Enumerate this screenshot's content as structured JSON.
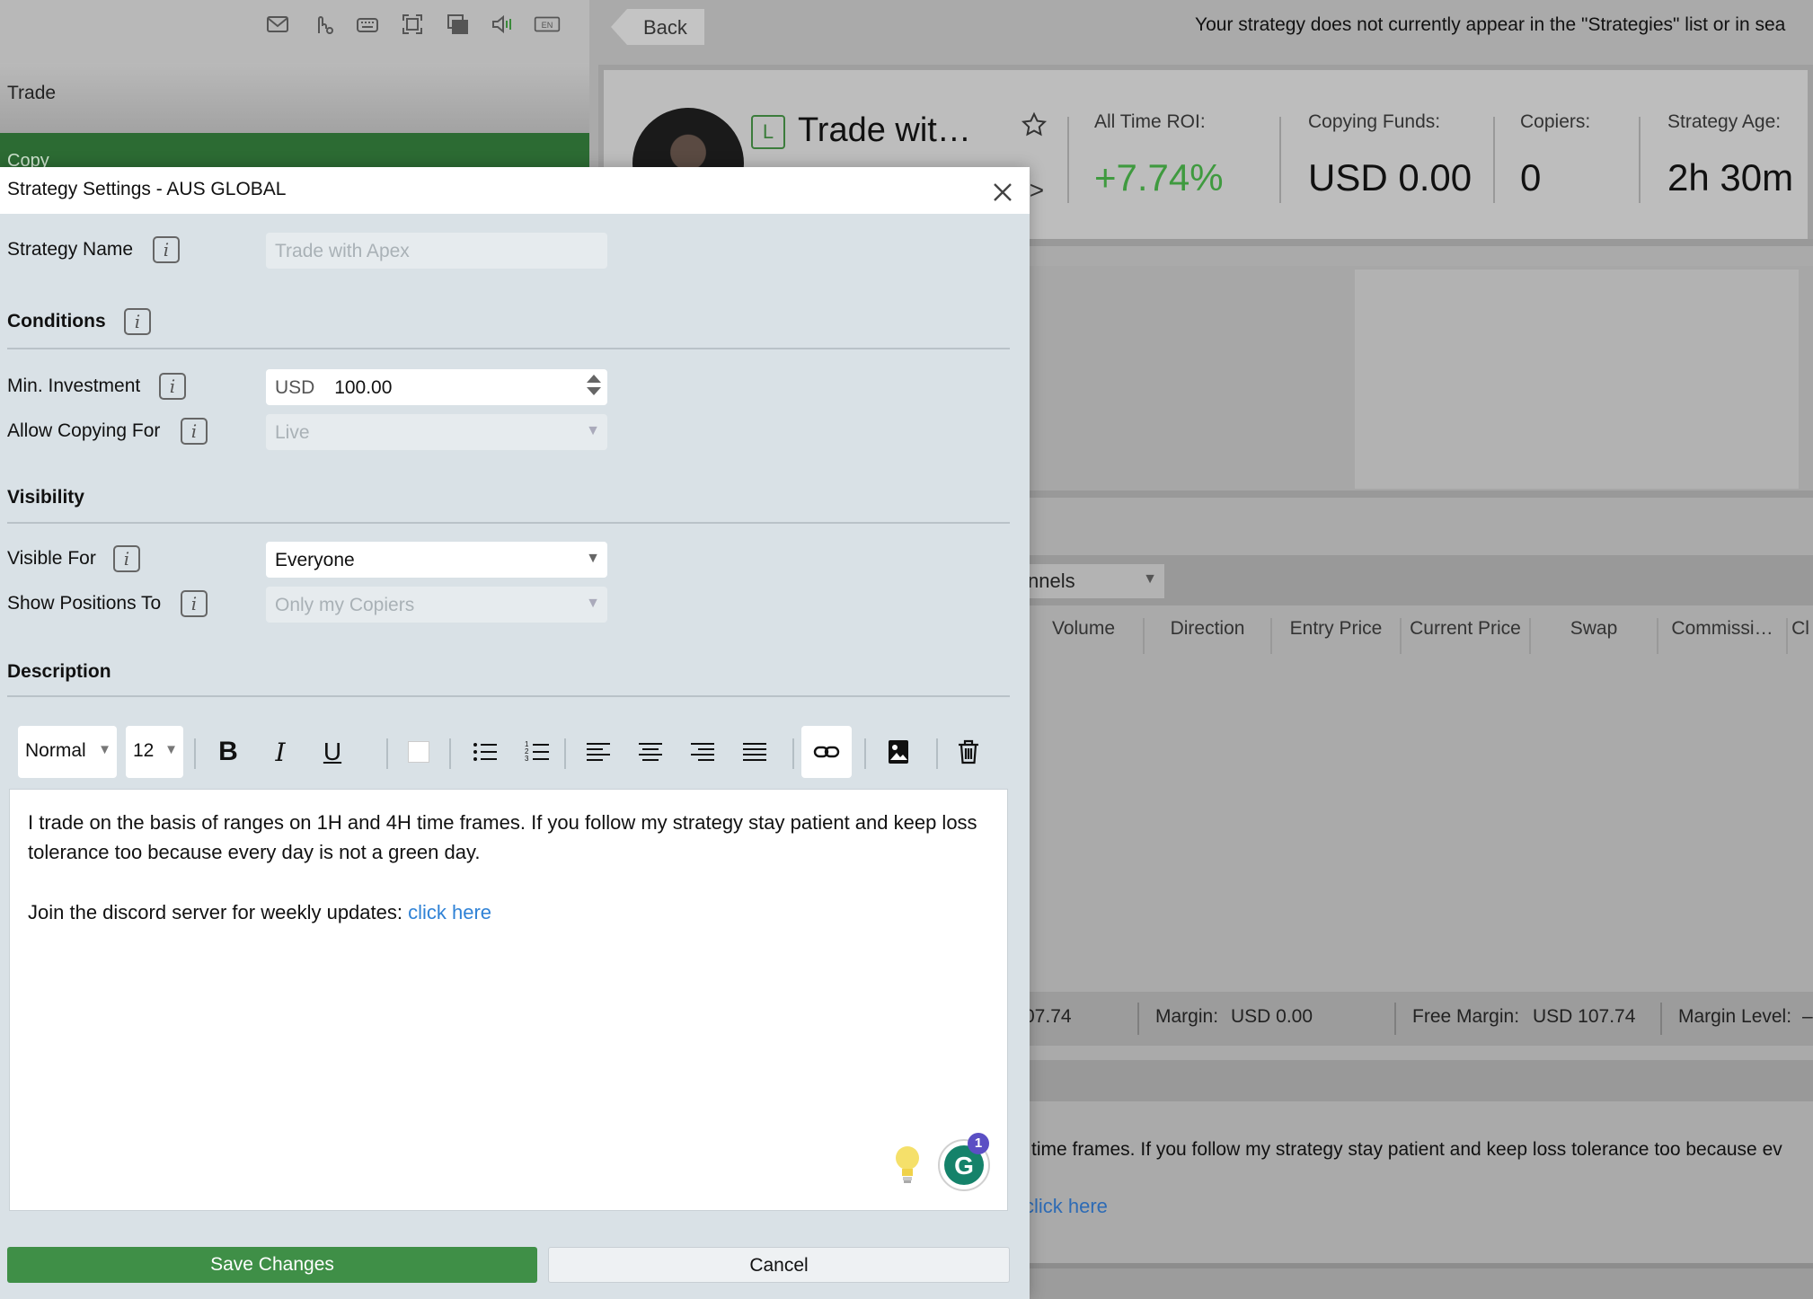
{
  "background": {
    "toolbar_icons": [
      "mail-icon",
      "touch-settings-icon",
      "keyboard-icon",
      "fullscreen-icon",
      "windows-icon",
      "volume-icon",
      "language-icon"
    ],
    "language_label": "EN",
    "left_trade_label": "Trade",
    "left_copy_label": "Copy",
    "back_label": "Back",
    "notice": "Your strategy does not currently appear in the \"Strategies\" list or in sea",
    "strategy_type_badge": "L",
    "strategy_title": "Trade wit…",
    "code_symbol": "/>",
    "stats": {
      "roi_label": "All Time ROI:",
      "roi_value": "+7.74%",
      "funds_label": "Copying Funds:",
      "funds_value": "USD 0.00",
      "copiers_label": "Copiers:",
      "copiers_value": "0",
      "age_label": "Strategy Age:",
      "age_value": "2h 30m"
    },
    "channels_value": "nnels",
    "columns": [
      "Volume",
      "Direction",
      "Entry Price",
      "Current Price",
      "Swap",
      "Commissi…",
      "Cl"
    ],
    "account": {
      "balance_partial": "07.74",
      "margin_label": "Margin:",
      "margin_value": "USD 0.00",
      "free_margin_label": "Free Margin:",
      "free_margin_value": "USD 107.74",
      "margin_level_label": "Margin Level:",
      "margin_level_value": "–"
    },
    "desc_text": "time frames. If you follow my strategy stay patient and keep loss tolerance too because ev",
    "desc_link": "click here"
  },
  "modal": {
    "title": "Strategy Settings - AUS GLOBAL",
    "strategy_name_label": "Strategy Name",
    "strategy_name_value": "Trade with Apex",
    "conditions_title": "Conditions",
    "min_investment_label": "Min. Investment",
    "min_investment_currency": "USD",
    "min_investment_value": "100.00",
    "allow_copying_label": "Allow Copying For",
    "allow_copying_value": "Live",
    "visibility_title": "Visibility",
    "visible_for_label": "Visible For",
    "visible_for_value": "Everyone",
    "show_positions_label": "Show Positions To",
    "show_positions_value": "Only my Copiers",
    "description_title": "Description",
    "editor": {
      "style_value": "Normal",
      "size_value": "12",
      "bold_glyph": "B",
      "italic_glyph": "I",
      "underline_glyph": "U",
      "paragraph1": "I trade on the basis of ranges on 1H and 4H time frames. If you follow my strategy stay patient and keep loss tolerance too because every day is not a green day.",
      "paragraph2_text": "Join the discord server for weekly updates: ",
      "paragraph2_link": "click here",
      "grammarly_count": "1"
    },
    "save_label": "Save Changes",
    "cancel_label": "Cancel",
    "info_glyph": "i"
  },
  "colors": {
    "accent_green": "#3f8f47",
    "roi_green": "#3f9a3f",
    "link_blue": "#2f82d6",
    "modal_bg": "#d9e1e6"
  }
}
